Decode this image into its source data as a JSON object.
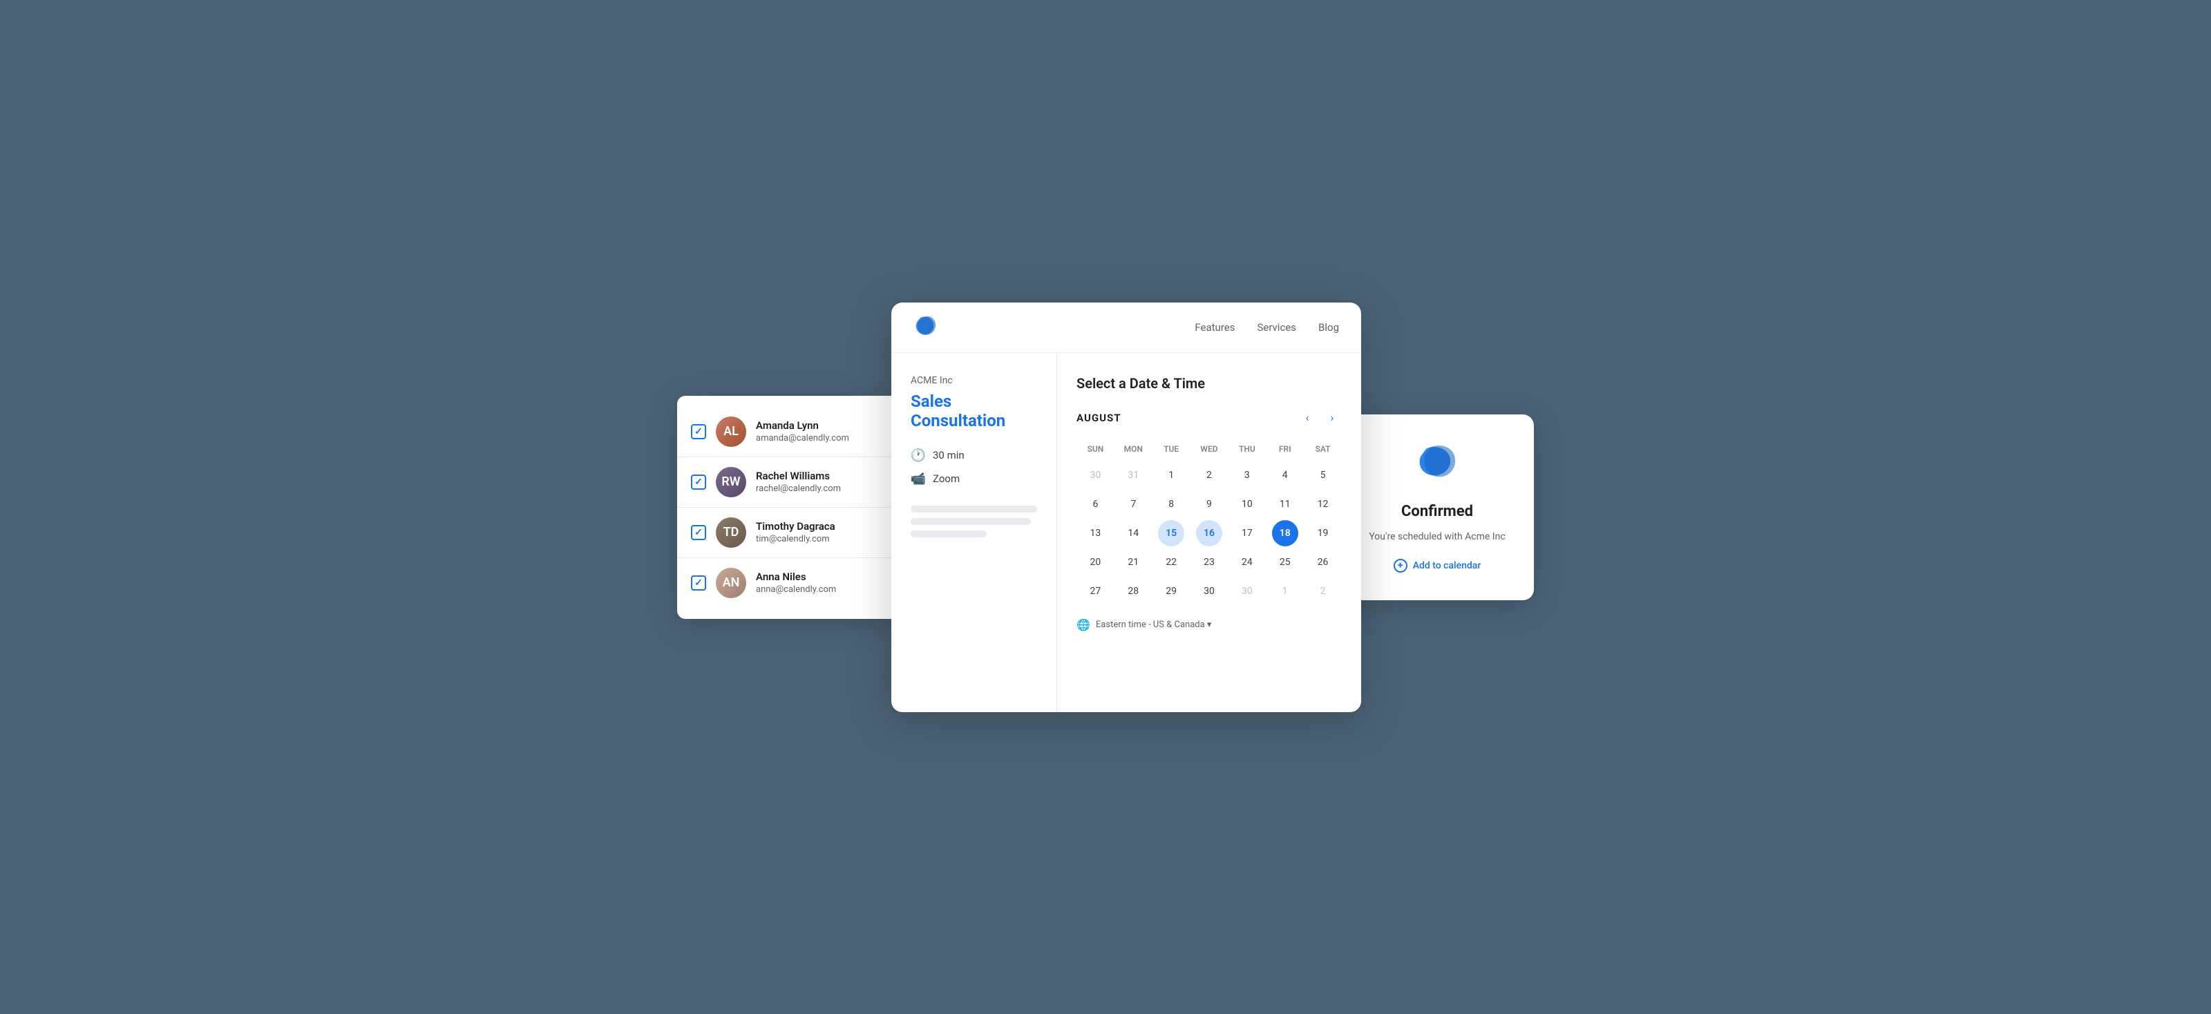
{
  "nav": {
    "features_label": "Features",
    "services_label": "Services",
    "blog_label": "Blog"
  },
  "user_list": {
    "users": [
      {
        "name": "Amanda Lynn",
        "email": "amanda@calendly.com",
        "initials": "AL",
        "avatar_class": "avatar-1"
      },
      {
        "name": "Rachel Williams",
        "email": "rachel@calendly.com",
        "initials": "RW",
        "avatar_class": "avatar-2"
      },
      {
        "name": "Timothy Dagraca",
        "email": "tim@calendly.com",
        "initials": "TD",
        "avatar_class": "avatar-3"
      },
      {
        "name": "Anna Niles",
        "email": "anna@calendly.com",
        "initials": "AN",
        "avatar_class": "avatar-4"
      }
    ]
  },
  "booking": {
    "company": "ACME Inc",
    "title": "Sales Consultation",
    "duration": "30 min",
    "platform": "Zoom",
    "calendar_title": "Select a Date & Time",
    "month": "AUGUST",
    "day_headers": [
      "SUN",
      "MON",
      "TUE",
      "WED",
      "THU",
      "FRI",
      "SAT"
    ],
    "weeks": [
      [
        {
          "day": "30",
          "type": "inactive"
        },
        {
          "day": "31",
          "type": "inactive"
        },
        {
          "day": "1",
          "type": "available"
        },
        {
          "day": "2",
          "type": "available"
        },
        {
          "day": "3",
          "type": "available"
        },
        {
          "day": "4",
          "type": "available"
        },
        {
          "day": "5",
          "type": "available"
        }
      ],
      [
        {
          "day": "6",
          "type": "available"
        },
        {
          "day": "7",
          "type": "available"
        },
        {
          "day": "8",
          "type": "available"
        },
        {
          "day": "9",
          "type": "available"
        },
        {
          "day": "10",
          "type": "available"
        },
        {
          "day": "11",
          "type": "available"
        },
        {
          "day": "12",
          "type": "available"
        }
      ],
      [
        {
          "day": "13",
          "type": "available"
        },
        {
          "day": "14",
          "type": "available"
        },
        {
          "day": "15",
          "type": "highlighted"
        },
        {
          "day": "16",
          "type": "highlighted"
        },
        {
          "day": "17",
          "type": "available"
        },
        {
          "day": "18",
          "type": "selected"
        },
        {
          "day": "19",
          "type": "available"
        }
      ],
      [
        {
          "day": "20",
          "type": "available"
        },
        {
          "day": "21",
          "type": "available"
        },
        {
          "day": "22",
          "type": "available"
        },
        {
          "day": "23",
          "type": "available"
        },
        {
          "day": "24",
          "type": "available"
        },
        {
          "day": "25",
          "type": "available"
        },
        {
          "day": "26",
          "type": "available"
        }
      ],
      [
        {
          "day": "27",
          "type": "available"
        },
        {
          "day": "28",
          "type": "available"
        },
        {
          "day": "29",
          "type": "available"
        },
        {
          "day": "30",
          "type": "available"
        },
        {
          "day": "30",
          "type": "inactive"
        },
        {
          "day": "1",
          "type": "inactive"
        },
        {
          "day": "2",
          "type": "inactive"
        }
      ]
    ],
    "timezone": "Eastern time - US & Canada ▾"
  },
  "confirmed": {
    "title": "Confirmed",
    "subtitle": "You're scheduled with Acme Inc",
    "add_calendar_label": "Add to calendar"
  }
}
